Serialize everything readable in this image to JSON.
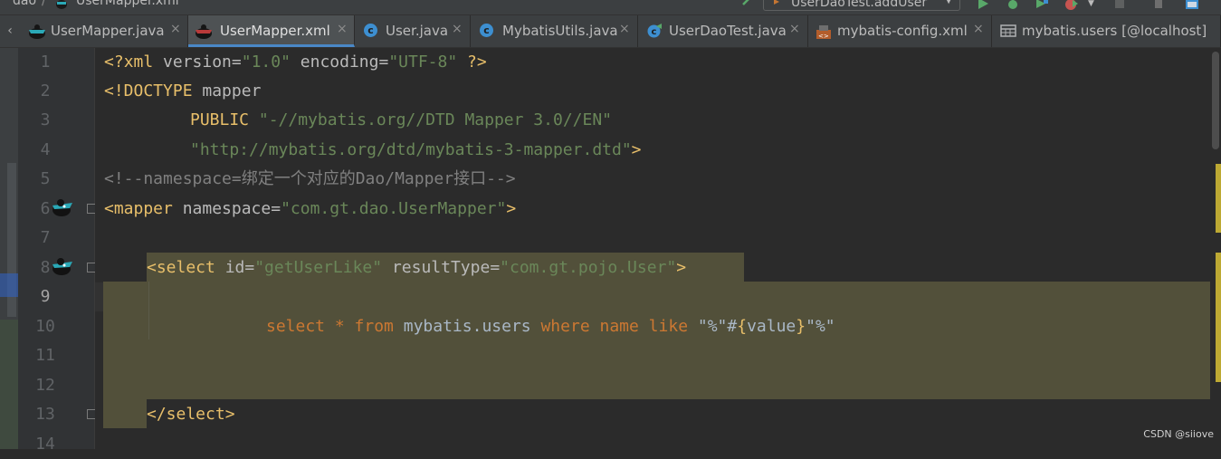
{
  "breadcrumb": {
    "folder": "dao",
    "file": "UserMapper.xml"
  },
  "run_config": {
    "label": "UserDaoTest.addUser"
  },
  "tabs": [
    {
      "label": "UserMapper.java",
      "icon": "mybatis-mapper-icon",
      "active": false
    },
    {
      "label": "UserMapper.xml",
      "icon": "mybatis-mapper-icon",
      "active": true
    },
    {
      "label": "User.java",
      "icon": "java-class-icon",
      "active": false
    },
    {
      "label": "MybatisUtils.java",
      "icon": "java-class-icon",
      "active": false
    },
    {
      "label": "UserDaoTest.java",
      "icon": "java-test-class-icon",
      "active": false
    },
    {
      "label": "mybatis-config.xml",
      "icon": "xml-config-icon",
      "active": false
    },
    {
      "label": "mybatis.users [@localhost]",
      "icon": "db-table-icon",
      "active": false
    }
  ],
  "tab_close_glyph": "×",
  "gutter": {
    "line_numbers": [
      "1",
      "2",
      "3",
      "4",
      "5",
      "6",
      "7",
      "8",
      "9",
      "10",
      "11",
      "12",
      "13",
      "14"
    ],
    "current_line": "9"
  },
  "code": {
    "l1": {
      "lt": "<?",
      "name": "xml",
      "a1": " version",
      "eq1": "=",
      "v1": "\"1.0\"",
      "a2": " encoding",
      "eq2": "=",
      "v2": "\"UTF-8\"",
      "end": " ?>"
    },
    "l2": {
      "open": "<!DOCTYPE",
      "rest": " mapper"
    },
    "l3": {
      "kw": "PUBLIC",
      "str": " \"-//mybatis.org//DTD Mapper 3.0//EN\""
    },
    "l4": {
      "str": "\"http://mybatis.org/dtd/mybatis-3-mapper.dtd\"",
      "end": ">"
    },
    "l5": {
      "comment": "<!--namespace=绑定一个对应的Dao/Mapper接口-->"
    },
    "l6": {
      "open": "<mapper",
      "attr": " namespace",
      "eq": "=",
      "val": "\"com.gt.dao.UserMapper\"",
      "end": ">"
    },
    "l8": {
      "open": "<select",
      "a1": " id",
      "eq1": "=",
      "v1": "\"getUserLike\"",
      "a2": " resultType",
      "eq2": "=",
      "v2": "\"com.gt.pojo.User\"",
      "end": ">"
    },
    "l10": {
      "k1": "select",
      "star": " * ",
      "k2": "from",
      "table": " mybatis.users ",
      "k3": "where",
      "k4": " name",
      "k5": " like",
      "p1": " \"%\"",
      "p2": "#",
      "p3": "{",
      "p4": "value",
      "p5": "}",
      "p6": "\"%\""
    },
    "l13": {
      "close": "</select",
      "end": ">"
    }
  },
  "watermark": "CSDN @siiove",
  "colors": {
    "tag": "#e8bf6a",
    "string": "#6a8759",
    "comment": "#808080",
    "keyword": "#cc7832",
    "selection": "#52503a",
    "tab_accent": "#4a88c7"
  }
}
